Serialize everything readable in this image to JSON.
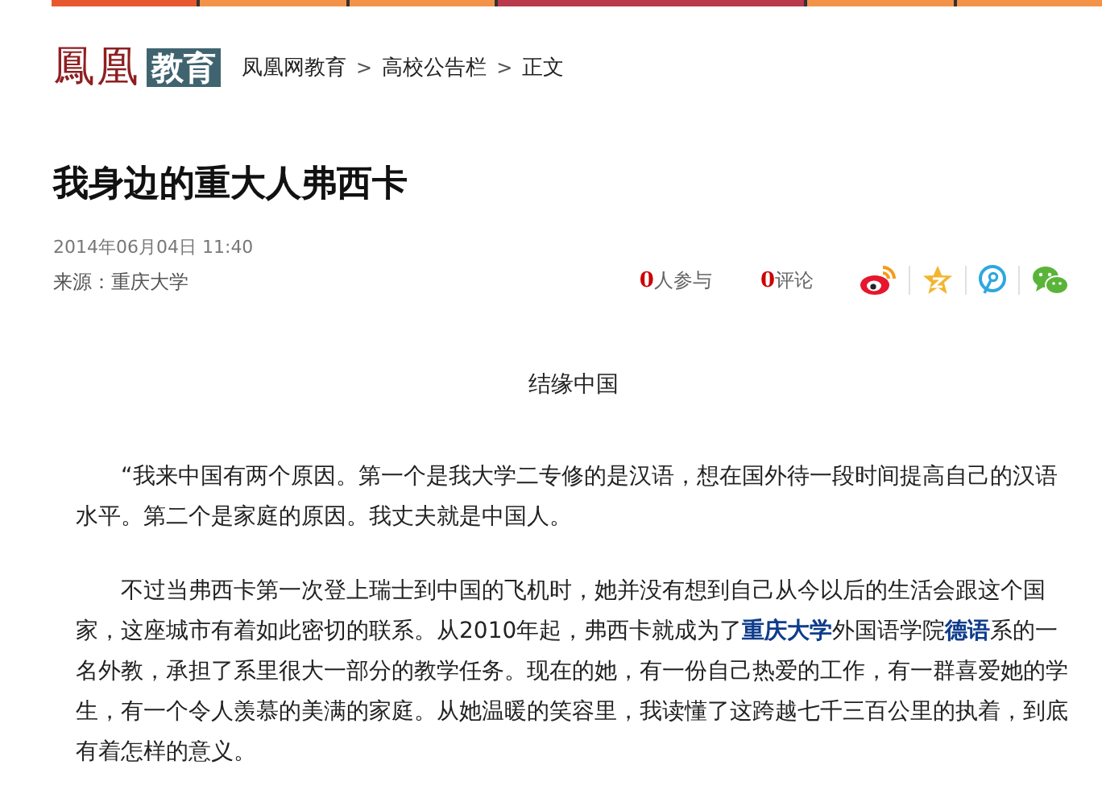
{
  "top_bar": {
    "segments": [
      {
        "color": "#e8582e"
      },
      {
        "color": "#f39249"
      },
      {
        "color": "#f39249"
      },
      {
        "color": "#b83a4c"
      },
      {
        "color": "#f39249"
      },
      {
        "color": "#f39249"
      }
    ]
  },
  "logo": {
    "name": "鳳凰",
    "channel": "教育"
  },
  "breadcrumb": [
    "凤凰网教育",
    "高校公告栏",
    "正文"
  ],
  "breadcrumb_separator": ">",
  "article": {
    "title": "我身边的重大人弗西卡",
    "date": "2014年06月04日  11:40",
    "source": "来源：重庆大学",
    "participants": {
      "count": "0",
      "label": "人参与"
    },
    "comments": {
      "count": "0",
      "label": "评论"
    },
    "share": [
      {
        "kind": "weibo"
      },
      {
        "kind": "qzone"
      },
      {
        "kind": "tencent"
      },
      {
        "kind": "wechat"
      }
    ],
    "subtitle": "结缘中国",
    "paragraphs": [
      [
        {
          "kind": "text",
          "text": "“我来中国有两个原因。第一个是我大学二专修的是汉语，想在国外待一段时间提高自己的汉语水平。第二个是家庭的原因。我丈夫就是中国人。"
        }
      ],
      [
        {
          "kind": "text",
          "text": "不过当弗西卡第一次登上瑞士到中国的飞机时，她并没有想到自己从今以后的生活会跟这个国家，这座城市有着如此密切的联系。从2010年起，弗西卡就成为了"
        },
        {
          "kind": "link",
          "text": "重庆大学"
        },
        {
          "kind": "text",
          "text": "外国语学院"
        },
        {
          "kind": "link",
          "text": "德语"
        },
        {
          "kind": "text",
          "text": "系的一名外教，承担了系里很大一部分的教学任务。现在的她，有一份自己热爱的工作，有一群喜爱她的学生，有一个令人羡慕的美满的家庭。从她温暖的笑容里，我读懂了这跨越七千三百公里的执着，到底有着怎样的意义。"
        }
      ]
    ]
  }
}
